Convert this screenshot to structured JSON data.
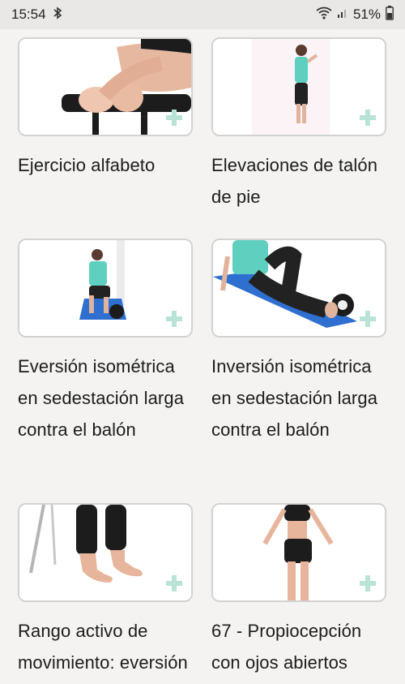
{
  "status": {
    "time": "15:54",
    "battery": "51%"
  },
  "exercises": [
    {
      "title": "Ejercicio alfabeto"
    },
    {
      "title": "Elevaciones de talón de pie"
    },
    {
      "title": "Eversión isométrica en sedestación larga contra el balón"
    },
    {
      "title": "Inversión isométrica en sedestación larga contra el balón"
    },
    {
      "title": "Rango activo de movimiento: eversión del tobillo"
    },
    {
      "title": "67 - Propiocepción con ojos abiertos"
    }
  ],
  "colors": {
    "accent_plus": "#b8e3d6",
    "shirt": "#5fd0c0",
    "mat": "#2f6fd0"
  }
}
